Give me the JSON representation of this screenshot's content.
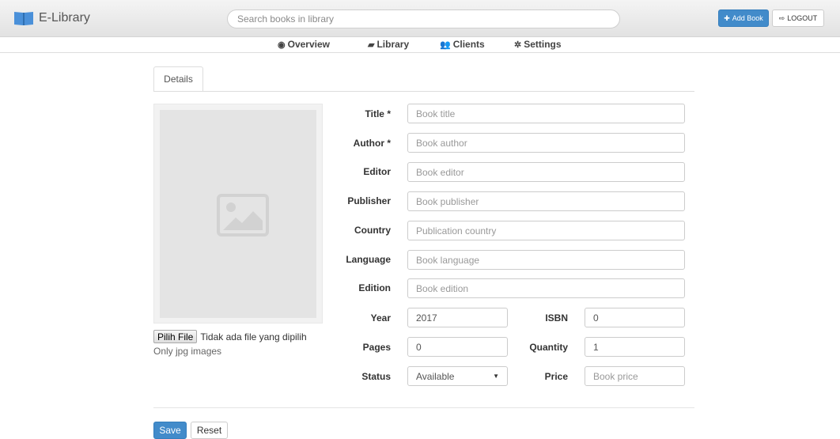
{
  "header": {
    "brand": "E-Library",
    "search_placeholder": "Search books in library",
    "add_book_label": "Add Book",
    "logout_label": "LOGOUT"
  },
  "nav": {
    "items": [
      {
        "label": "Overview",
        "icon": "dashboard-icon"
      },
      {
        "label": "Library",
        "icon": "book-icon"
      },
      {
        "label": "Clients",
        "icon": "users-icon"
      },
      {
        "label": "Settings",
        "icon": "gear-icon"
      }
    ]
  },
  "tabs": [
    {
      "label": "Details"
    }
  ],
  "image_upload": {
    "button_label": "Pilih File",
    "status_text": "Tidak ada file yang dipilih",
    "help_text": "Only jpg images"
  },
  "form": {
    "title": {
      "label": "Title *",
      "placeholder": "Book title"
    },
    "author": {
      "label": "Author *",
      "placeholder": "Book author"
    },
    "editor": {
      "label": "Editor",
      "placeholder": "Book editor"
    },
    "publisher": {
      "label": "Publisher",
      "placeholder": "Book publisher"
    },
    "country": {
      "label": "Country",
      "placeholder": "Publication country"
    },
    "language": {
      "label": "Language",
      "placeholder": "Book language"
    },
    "edition": {
      "label": "Edition",
      "placeholder": "Book edition"
    },
    "year": {
      "label": "Year",
      "value": "2017"
    },
    "isbn": {
      "label": "ISBN",
      "value": "0"
    },
    "pages": {
      "label": "Pages",
      "value": "0"
    },
    "quantity": {
      "label": "Quantity",
      "value": "1"
    },
    "status": {
      "label": "Status",
      "value": "Available"
    },
    "price": {
      "label": "Price",
      "placeholder": "Book price"
    }
  },
  "actions": {
    "save_label": "Save",
    "reset_label": "Reset"
  },
  "colors": {
    "primary": "#428bca",
    "brand_icon": "#4a90d9"
  }
}
